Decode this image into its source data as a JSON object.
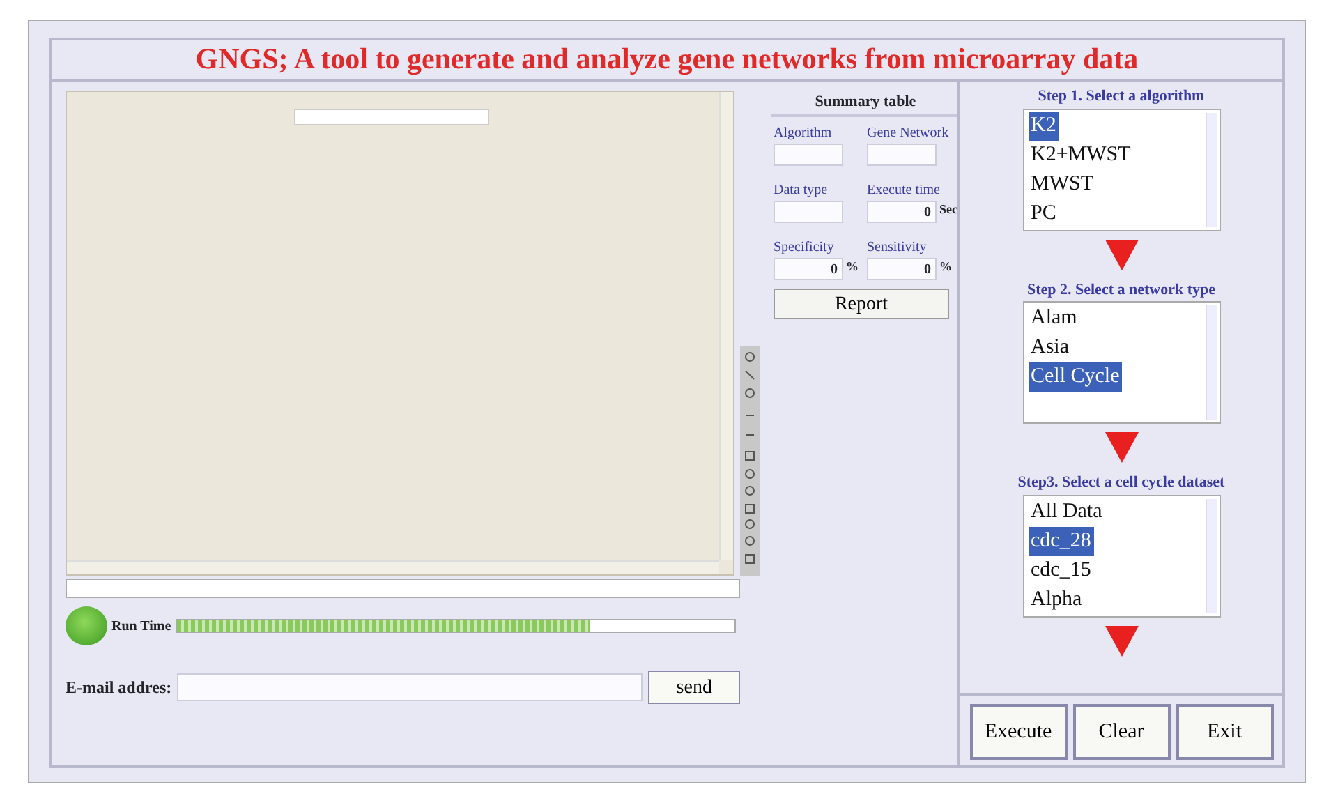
{
  "title": "GNGS; A tool to generate and analyze gene networks from microarray data",
  "summary": {
    "title": "Summary table",
    "fields": [
      {
        "label": "Algorithm"
      },
      {
        "label": "Gene Network"
      },
      {
        "label": "Data type"
      },
      {
        "label": "Execute time",
        "value": "0",
        "unit": "Sec"
      },
      {
        "label": "Specificity",
        "value": "0",
        "unit": "%"
      },
      {
        "label": "Sensitivity",
        "value": "0",
        "unit": "%"
      }
    ],
    "report_button": "Report"
  },
  "run_time": {
    "label": "Run Time",
    "level": 0.74
  },
  "email": {
    "label": "E-mail addres:",
    "button": "send"
  },
  "steps": [
    {
      "label": "Step 1. Select a algorithm",
      "items": [
        {
          "text": "K2",
          "selected": true
        },
        {
          "text": "K2+MWST",
          "selected": false
        },
        {
          "text": "MWST",
          "selected": false
        },
        {
          "text": "PC",
          "selected": false
        }
      ]
    },
    {
      "label": "Step 2. Select a network type",
      "items": [
        {
          "text": "Alam",
          "selected": false
        },
        {
          "text": "Asia",
          "selected": false
        },
        {
          "text": "Cell Cycle",
          "selected": true
        }
      ]
    },
    {
      "label": "Step3. Select a cell cycle dataset",
      "items": [
        {
          "text": "All Data",
          "selected": false
        },
        {
          "text": "cdc_28",
          "selected": true
        },
        {
          "text": "cdc_15",
          "selected": false
        },
        {
          "text": "Alpha",
          "selected": false
        }
      ]
    }
  ],
  "buttons": [
    "Execute",
    "Clear",
    "Exit"
  ]
}
